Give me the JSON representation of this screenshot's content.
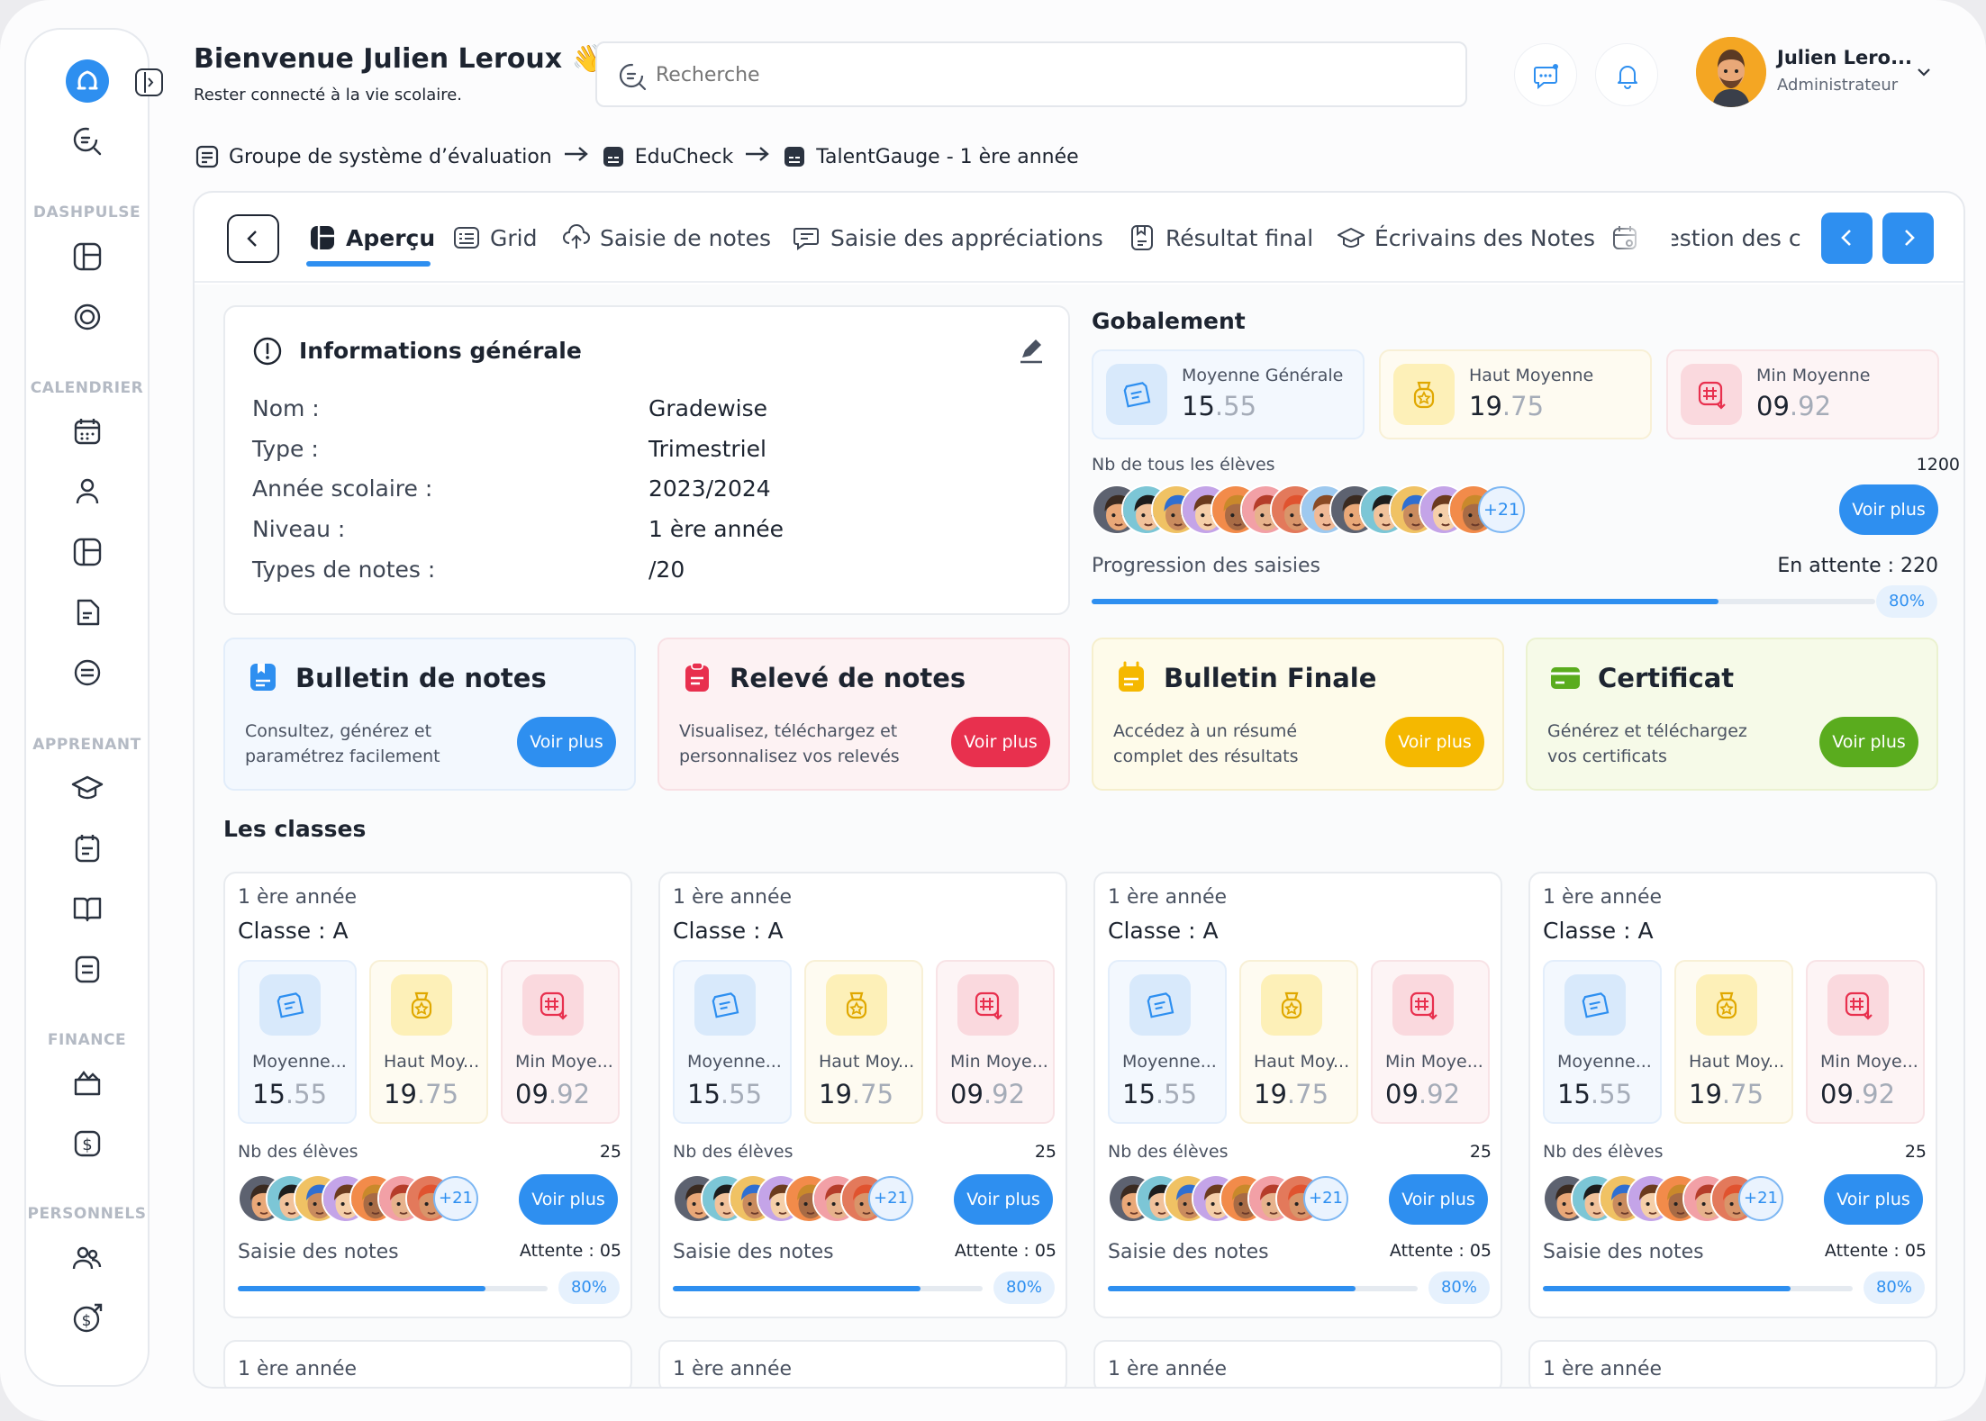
{
  "header": {
    "welcome": "Bienvenue Julien Leroux 👋",
    "subtitle": "Rester connecté à la vie scolaire.",
    "search_placeholder": "Recherche",
    "user_name": "Julien Lero...",
    "user_role": "Administrateur"
  },
  "sidebar": {
    "sections": [
      "DASHPULSE",
      "CALENDRIER",
      "APPRENANT",
      "FINANCE",
      "PERSONNELS"
    ]
  },
  "breadcrumb": [
    "Groupe de système d’évaluation",
    "EduCheck",
    "TalentGauge - 1 ère année"
  ],
  "tabs": [
    {
      "label": "Aperçu",
      "active": true
    },
    {
      "label": "Grid"
    },
    {
      "label": "Saisie de notes"
    },
    {
      "label": "Saisie des appréciations"
    },
    {
      "label": "Résultat final"
    },
    {
      "label": "Écrivains des Notes"
    },
    {
      "label": "Gestion des c"
    }
  ],
  "info": {
    "title": "Informations générale",
    "rows": [
      {
        "label": "Nom :",
        "value": "Gradewise"
      },
      {
        "label": "Type :",
        "value": "Trimestriel"
      },
      {
        "label": "Année scolaire :",
        "value": "2023/2024"
      },
      {
        "label": "Niveau :",
        "value": "1 ère année"
      },
      {
        "label": "Types de notes :",
        "value": "/20"
      }
    ]
  },
  "overall": {
    "title": "Gobalement",
    "stats": [
      {
        "label": "Moyenne Générale",
        "int": "15",
        "dec": ".55"
      },
      {
        "label": "Haut Moyenne",
        "int": "19",
        "dec": ".75"
      },
      {
        "label": "Min Moyenne",
        "int": "09",
        "dec": ".92"
      }
    ],
    "students_label": "Nb de tous les élèves",
    "students_count": "1200",
    "more_avatars": "+21",
    "see_more": "Voir plus",
    "progress_label": "Progression des saisies",
    "pending": "En attente : 220",
    "progress_value": 0.8,
    "progress_text": "80%"
  },
  "features": [
    {
      "title": "Bulletin de notes",
      "desc": "Consultez, générez et paramétrez facilement",
      "button": "Voir plus",
      "accent": "#2e8ff0"
    },
    {
      "title": "Relevé de notes",
      "desc": "Visualisez, téléchargez et personnalisez vos relevés",
      "button": "Voir plus",
      "accent": "#e8304e"
    },
    {
      "title": "Bulletin Finale",
      "desc": "Accédez à un résumé complet des résultats",
      "button": "Voir plus",
      "accent": "#f5b800"
    },
    {
      "title": "Certificat",
      "desc": "Générez et téléchargez vos certificats",
      "button": "Voir plus",
      "accent": "#5aac1e"
    }
  ],
  "classes_title": "Les classes",
  "classes": [
    {
      "year": "1 ère année",
      "name": "Classe : A",
      "m1": "Moyenne...",
      "m2": "Haut Moy...",
      "m3": "Min Moye...",
      "v1i": "15",
      "v1d": ".55",
      "v2i": "19",
      "v2d": ".75",
      "v3i": "09",
      "v3d": ".92",
      "nb_label": "Nb des élèves",
      "nb": "25",
      "more": "+21",
      "button": "Voir plus",
      "saisie": "Saisie des notes",
      "attente": "Attente : 05",
      "progress": 0.8,
      "progress_text": "80%"
    },
    {
      "year": "1 ère année",
      "name": "Classe : A",
      "m1": "Moyenne...",
      "m2": "Haut Moy...",
      "m3": "Min Moye...",
      "v1i": "15",
      "v1d": ".55",
      "v2i": "19",
      "v2d": ".75",
      "v3i": "09",
      "v3d": ".92",
      "nb_label": "Nb des élèves",
      "nb": "25",
      "more": "+21",
      "button": "Voir plus",
      "saisie": "Saisie des notes",
      "attente": "Attente : 05",
      "progress": 0.8,
      "progress_text": "80%"
    },
    {
      "year": "1 ère année",
      "name": "Classe : A",
      "m1": "Moyenne...",
      "m2": "Haut Moy...",
      "m3": "Min Moye...",
      "v1i": "15",
      "v1d": ".55",
      "v2i": "19",
      "v2d": ".75",
      "v3i": "09",
      "v3d": ".92",
      "nb_label": "Nb des élèves",
      "nb": "25",
      "more": "+21",
      "button": "Voir plus",
      "saisie": "Saisie des notes",
      "attente": "Attente : 05",
      "progress": 0.8,
      "progress_text": "80%"
    },
    {
      "year": "1 ère année",
      "name": "Classe : A",
      "m1": "Moyenne...",
      "m2": "Haut Moy...",
      "m3": "Min Moye...",
      "v1i": "15",
      "v1d": ".55",
      "v2i": "19",
      "v2d": ".75",
      "v3i": "09",
      "v3d": ".92",
      "nb_label": "Nb des élèves",
      "nb": "25",
      "more": "+21",
      "button": "Voir plus",
      "saisie": "Saisie des notes",
      "attente": "Attente : 05",
      "progress": 0.8,
      "progress_text": "80%"
    }
  ],
  "colors": {
    "primary": "#2e8ff0",
    "red": "#e8304e",
    "yellow": "#f5b800",
    "green": "#5aac1e"
  }
}
